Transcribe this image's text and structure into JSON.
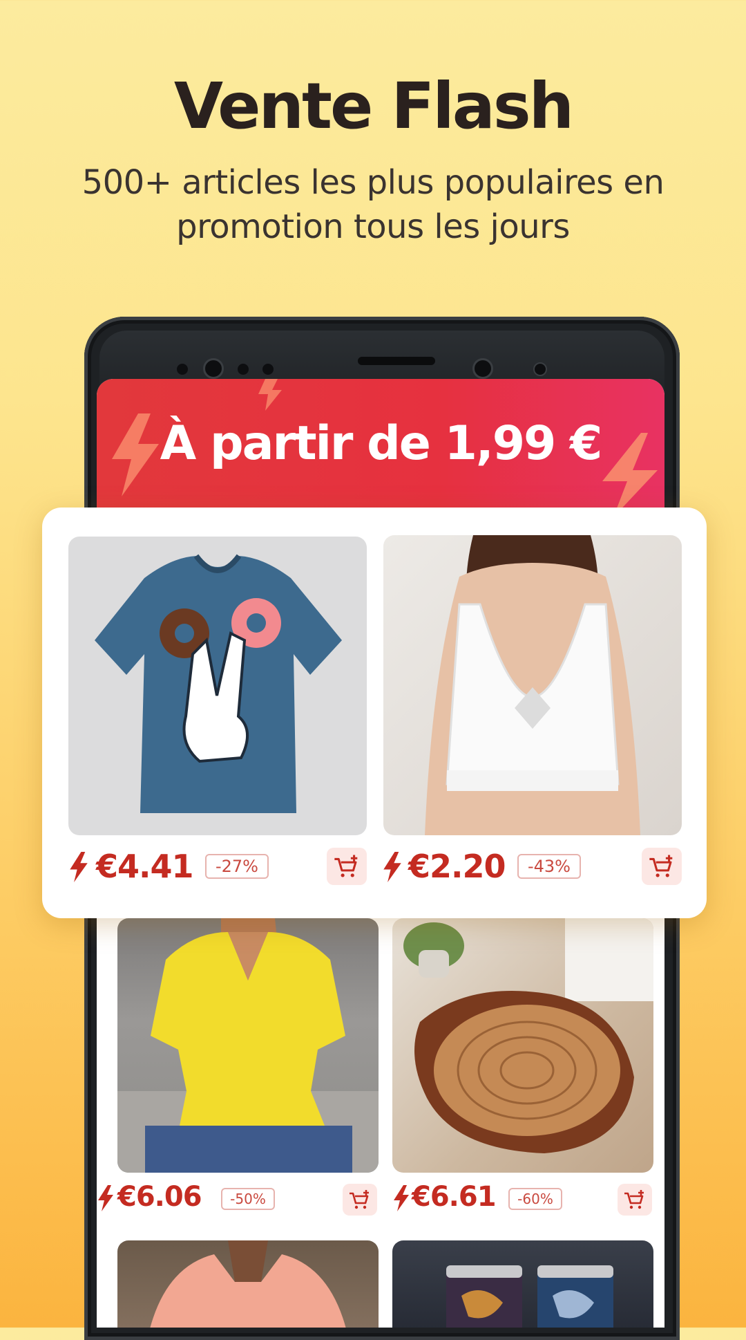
{
  "header": {
    "title": "Vente Flash",
    "subtitle_line1": "500+ articles les plus populaires en",
    "subtitle_line2": "promotion tous les jours"
  },
  "banner": {
    "text": "À partir de 1,99 €"
  },
  "featured_products": [
    {
      "name": "tshirt",
      "price": "€4.41",
      "discount": "-27%"
    },
    {
      "name": "bra",
      "price": "€2.20",
      "discount": "-43%"
    }
  ],
  "products": [
    {
      "name": "yellow-blouse",
      "price": "€6.06",
      "discount": "-50%"
    },
    {
      "name": "wood-rug",
      "price": "€6.61",
      "discount": "-60%"
    }
  ],
  "colors": {
    "price_red": "#C42B21",
    "banner_red": "#E2383C",
    "background_yellow": "#FDE58E",
    "cart_bg": "#FCE7E4"
  },
  "icons": [
    "lightning-bolt-icon",
    "add-to-cart-icon"
  ]
}
